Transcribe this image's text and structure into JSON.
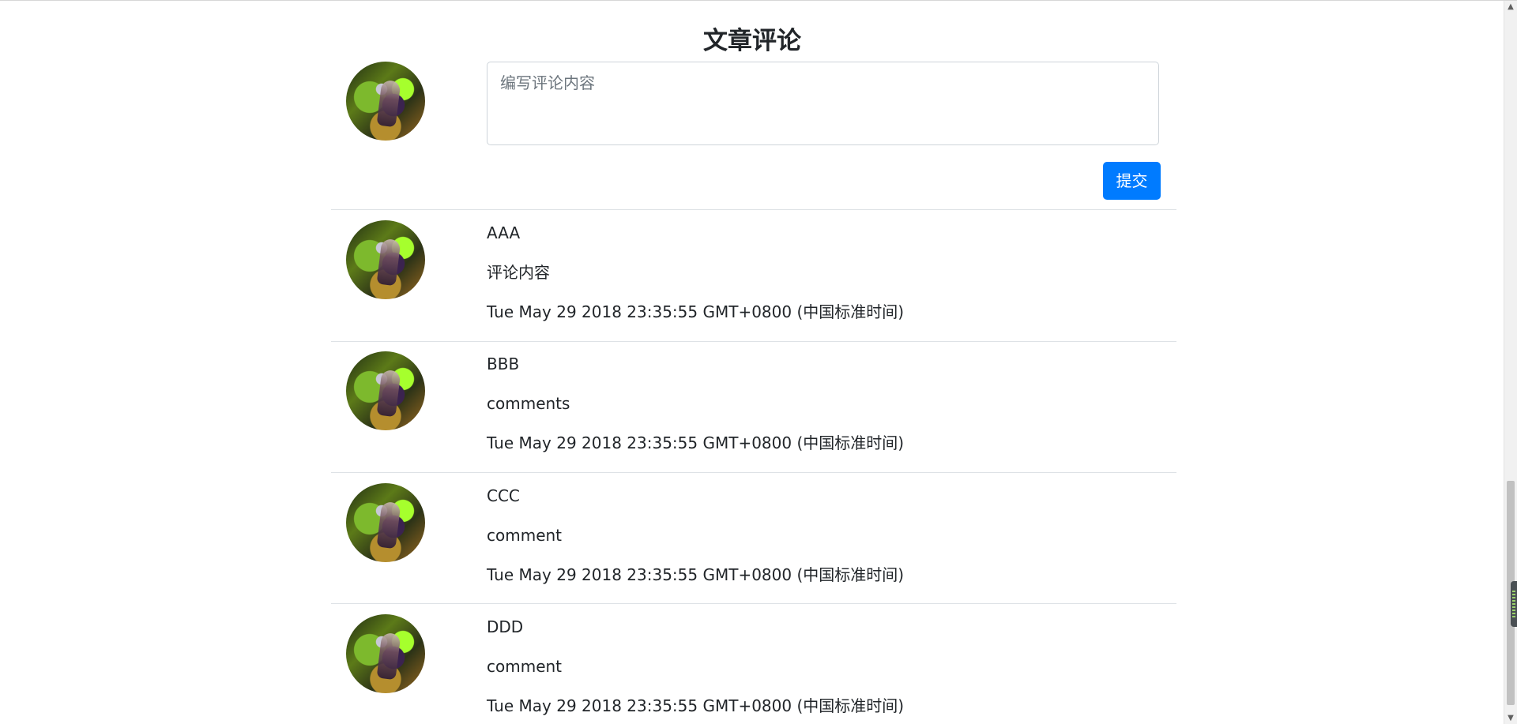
{
  "page": {
    "title": "文章评论"
  },
  "composer": {
    "placeholder": "编写评论内容",
    "submit_label": "提交"
  },
  "comments": [
    {
      "author": "AAA",
      "content": "评论内容",
      "time": "Tue May 29 2018 23:35:55 GMT+0800 (中国标准时间)"
    },
    {
      "author": "BBB",
      "content": "comments",
      "time": "Tue May 29 2018 23:35:55 GMT+0800 (中国标准时间)"
    },
    {
      "author": "CCC",
      "content": "comment",
      "time": "Tue May 29 2018 23:35:55 GMT+0800 (中国标准时间)"
    },
    {
      "author": "DDD",
      "content": "comment",
      "time": "Tue May 29 2018 23:35:55 GMT+0800 (中国标准时间)"
    }
  ],
  "icons": {
    "avatar": "user-avatar",
    "scroll_up": "chevron-up-icon",
    "scroll_down": "chevron-down-icon"
  },
  "colors": {
    "primary": "#007bff",
    "text": "#212529",
    "placeholder": "#6c757d",
    "divider": "#dee2e6"
  }
}
